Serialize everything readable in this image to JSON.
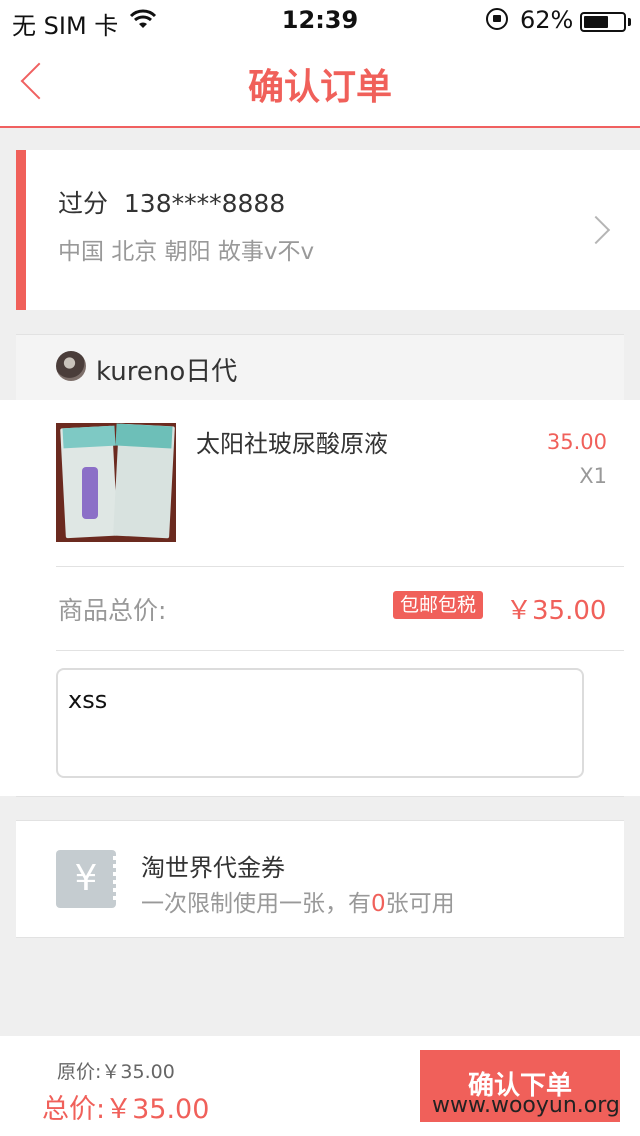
{
  "status_bar": {
    "carrier": "无 SIM 卡",
    "time": "12:39",
    "battery_percent": "62%",
    "battery_level": 0.62,
    "icons": [
      "wifi-icon",
      "rotation-lock-icon",
      "battery-icon"
    ]
  },
  "nav": {
    "title": "确认订单",
    "back_icon": "chevron-left-icon"
  },
  "address": {
    "name_phone": "过分  138****8888",
    "detail": "中国 北京 朝阳 故事v不v"
  },
  "shop": {
    "name": "kureno日代"
  },
  "product": {
    "title": "太阳社玻尿酸原液",
    "price": "35.00",
    "quantity": "X1"
  },
  "summary": {
    "total_label": "商品总价:",
    "badge": "包邮包税",
    "total_price": "￥35.00"
  },
  "remark": {
    "value": "xss"
  },
  "coupon": {
    "icon_glyph": "¥",
    "title": "淘世界代金券",
    "subtitle_prefix": "一次限制使用一张，有",
    "count": "0",
    "subtitle_suffix": "张可用"
  },
  "footer": {
    "original_price": "原价:￥35.00",
    "total_price": "总价:￥35.00",
    "confirm_label": "确认下单",
    "watermark": "www.wooyun.org"
  },
  "colors": {
    "accent": "#f0605a",
    "background": "#efefef"
  }
}
